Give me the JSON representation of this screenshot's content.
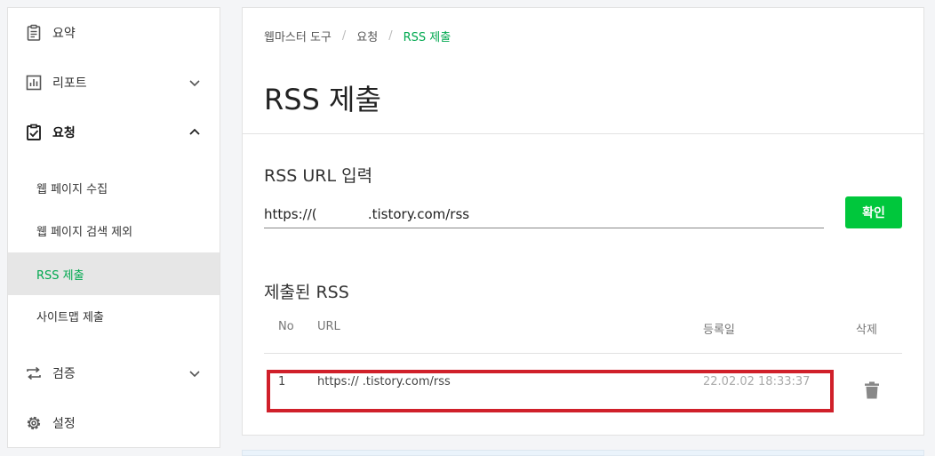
{
  "sidebar": {
    "summary": "요약",
    "report": "리포트",
    "request": "요청",
    "request_items": [
      "웹 페이지 수집",
      "웹 페이지 검색 제외",
      "RSS 제출",
      "사이트맵 제출"
    ],
    "verify": "검증",
    "settings": "설정"
  },
  "breadcrumb": [
    "웹마스터 도구",
    "요청",
    "RSS 제출"
  ],
  "page_title": "RSS 제출",
  "rss_input": {
    "label": "RSS URL 입력",
    "value": "https://(            .tistory.com/rss",
    "button": "확인"
  },
  "submitted": {
    "title": "제출된 RSS",
    "columns": {
      "no": "No",
      "url": "URL",
      "date": "등록일",
      "delete": "삭제"
    },
    "rows": [
      {
        "no": "1",
        "url": "https://            .tistory.com/rss",
        "date": "22.02.02 18:33:37"
      }
    ]
  },
  "colors": {
    "accent": "#00c73c",
    "highlight": "#d0202a"
  }
}
